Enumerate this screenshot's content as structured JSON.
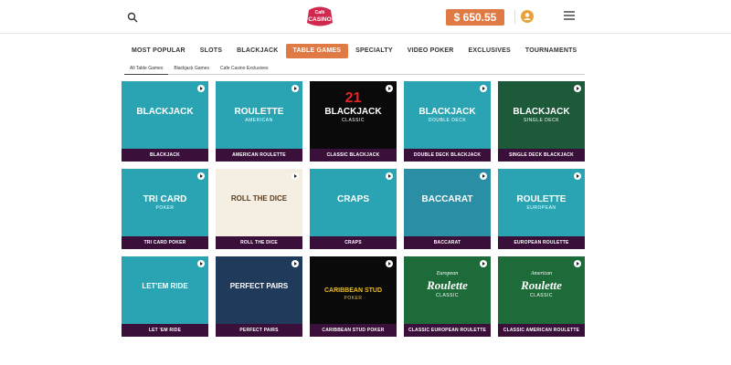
{
  "header": {
    "balance": "$ 650.55",
    "logo_text": "CASINO",
    "logo_top_text": "Café"
  },
  "nav": {
    "tabs": [
      {
        "label": "MOST POPULAR",
        "active": false
      },
      {
        "label": "SLOTS",
        "active": false
      },
      {
        "label": "BLACKJACK",
        "active": false
      },
      {
        "label": "TABLE GAMES",
        "active": true
      },
      {
        "label": "SPECIALTY",
        "active": false
      },
      {
        "label": "VIDEO POKER",
        "active": false
      },
      {
        "label": "EXCLUSIVES",
        "active": false
      },
      {
        "label": "TOURNAMENTS",
        "active": false
      }
    ],
    "subtabs": [
      {
        "label": "All Table Games",
        "active": true
      },
      {
        "label": "Blackjack Games",
        "active": false
      },
      {
        "label": "Cafe Casino Exclusives",
        "active": false
      }
    ]
  },
  "games": [
    {
      "label": "BLACKJACK",
      "art_text": "BLACKJACK",
      "bg": "#2aa3b3"
    },
    {
      "label": "AMERICAN ROULETTE",
      "art_text": "ROULETTE",
      "art_sub": "AMERICAN",
      "bg": "#2aa3b3"
    },
    {
      "label": "CLASSIC BLACKJACK",
      "art_text": "BLACKJACK",
      "art_sub": "CLASSIC",
      "art_num": "21",
      "bg": "#0a0a0a"
    },
    {
      "label": "DOUBLE DECK BLACKJACK",
      "art_text": "BLACKJACK",
      "art_sub": "DOUBLE DECK",
      "bg": "#2aa3b3"
    },
    {
      "label": "SINGLE DECK BLACKJACK",
      "art_text": "BLACKJACK",
      "art_sub": "SINGLE DECK",
      "bg": "#1d5a3a"
    },
    {
      "label": "TRI CARD POKER",
      "art_text": "TRI CARD",
      "art_sub": "POKER",
      "bg": "#2aa3b3"
    },
    {
      "label": "ROLL THE DICE",
      "art_text": "ROLL THE DICE",
      "bg": "#f4efe2"
    },
    {
      "label": "CRAPS",
      "art_text": "CRAPS",
      "bg": "#2aa3b3"
    },
    {
      "label": "BACCARAT",
      "art_text": "BACCARAT",
      "bg": "#2a8fa5"
    },
    {
      "label": "EUROPEAN ROULETTE",
      "art_text": "ROULETTE",
      "art_sub": "EUROPEAN",
      "bg": "#2aa3b3"
    },
    {
      "label": "LET 'EM RIDE",
      "art_text": "LET'EM RIDE",
      "bg": "#2aa3b3"
    },
    {
      "label": "PERFECT PAIRS",
      "art_text": "PERFECT PAIRS",
      "bg": "#1f3a5a"
    },
    {
      "label": "CARIBBEAN STUD POKER",
      "art_text": "CARIBBEAN STUD",
      "art_sub": "POKER",
      "bg": "#0a0a0a"
    },
    {
      "label": "CLASSIC EUROPEAN ROULETTE",
      "art_text": "Roulette",
      "art_sub": "CLASSIC",
      "art_top": "European",
      "bg": "#1e6b3a"
    },
    {
      "label": "CLASSIC AMERICAN ROULETTE",
      "art_text": "Roulette",
      "art_sub": "CLASSIC",
      "art_top": "American",
      "bg": "#1e6b3a"
    }
  ],
  "colors": {
    "accent": "#e07a45",
    "label_bar": "#3a0f3a",
    "teal": "#2aa3b3"
  }
}
